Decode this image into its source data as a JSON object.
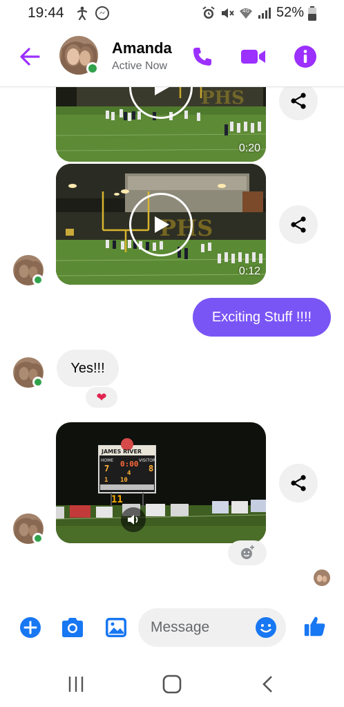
{
  "status_bar": {
    "time": "19:44",
    "battery": "52%",
    "icons": [
      "alarm-icon",
      "mute-icon",
      "wifi-icon",
      "signal-icon",
      "battery-icon",
      "messenger-notification-icon",
      "accessibility-icon"
    ]
  },
  "header": {
    "name": "Amanda",
    "status": "Active Now",
    "accent_color": "#9b30ff"
  },
  "messages": {
    "video1_duration": "0:20",
    "video2_duration": "0:12",
    "outgoing_text": "Exciting Stuff !!!!",
    "incoming_text": "Yes!!!",
    "reaction": "❤",
    "scoreboard": {
      "school": "JAMES RIVER",
      "home_label": "HOME",
      "visitor_label": "VISITOR",
      "home_score": "7",
      "visitor_score": "8",
      "clock": "0:00",
      "quarter": "4",
      "down": "1",
      "to_go": "10",
      "overlay_number": "11"
    }
  },
  "composer": {
    "placeholder": "Message"
  },
  "colors": {
    "outgoing_bubble": "#7a55f5",
    "incoming_bubble": "#f0f0f0",
    "composer_icons": "#1877f2",
    "online": "#31a24c"
  }
}
